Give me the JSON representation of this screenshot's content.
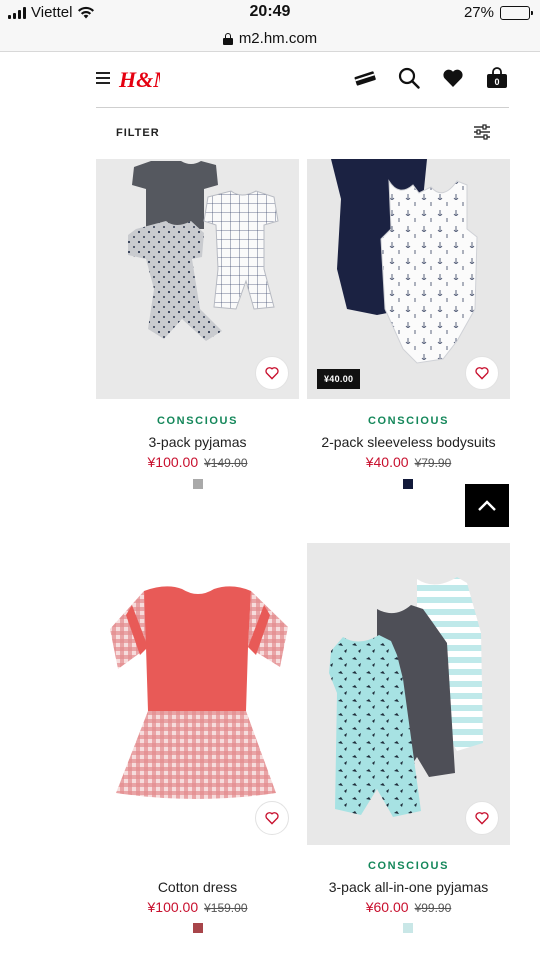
{
  "status_bar": {
    "carrier": "Viettel",
    "time": "20:49",
    "battery": "27%",
    "battery_level": 0.27
  },
  "browser": {
    "url": "m2.hm.com"
  },
  "header": {
    "logo_text": "H&M",
    "icons": [
      "menu-icon",
      "payment-card-icon",
      "search-icon",
      "heart-icon",
      "shopping-bag-icon"
    ],
    "bag_count": "0",
    "brand_color": "#e50010"
  },
  "filter": {
    "label": "FILTER"
  },
  "products": [
    {
      "tag": "CONSCIOUS",
      "name": "3-pack pyjamas",
      "sale_price": "¥100.00",
      "old_price": "¥149.00",
      "badge": "",
      "swatch_color": "#a9a9a9"
    },
    {
      "tag": "CONSCIOUS",
      "name": "2-pack sleeveless bodysuits",
      "sale_price": "¥40.00",
      "old_price": "¥79.90",
      "badge": "¥40.00",
      "swatch_color": "#121a3a"
    },
    {
      "tag": "",
      "name": "Cotton dress",
      "sale_price": "¥100.00",
      "old_price": "¥159.00",
      "badge": "",
      "swatch_color": "#a8454a"
    },
    {
      "tag": "CONSCIOUS",
      "name": "3-pack all-in-one pyjamas",
      "sale_price": "¥60.00",
      "old_price": "¥99.90",
      "badge": "",
      "swatch_color": "#c9e7e7"
    }
  ],
  "colors": {
    "sale": "#c8102e",
    "conscious": "#14875a"
  }
}
